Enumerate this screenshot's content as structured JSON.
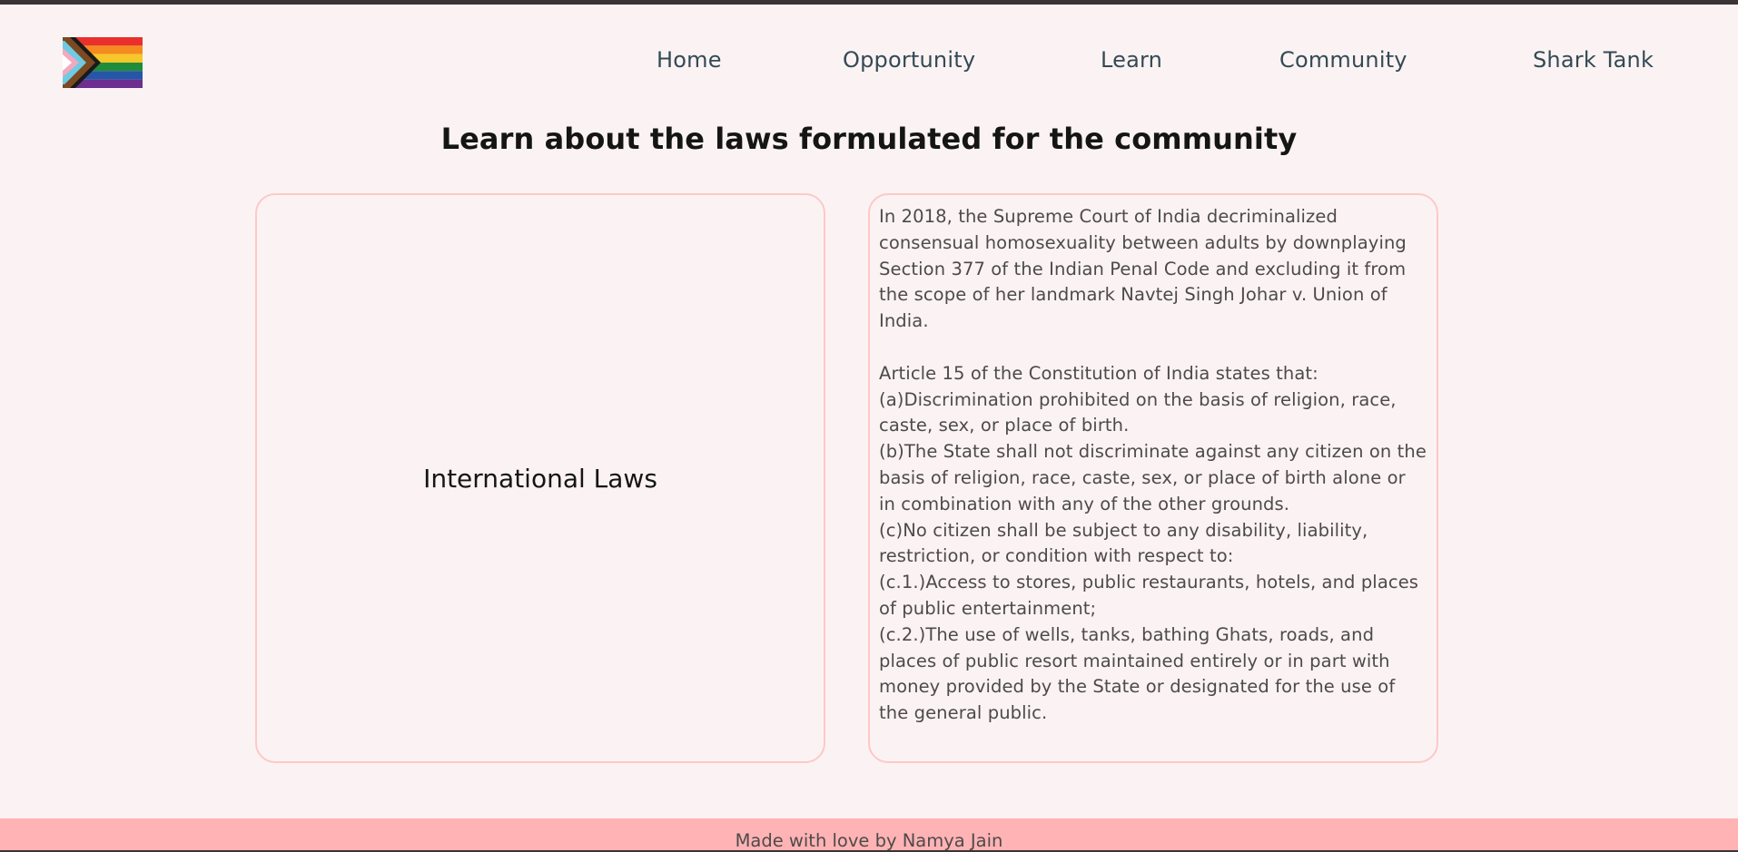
{
  "nav": {
    "items": [
      "Home",
      "Opportunity",
      "Learn",
      "Community",
      "Shark Tank"
    ]
  },
  "logo": {
    "icon": "progress-pride-flag-icon",
    "colors": {
      "red": "#e9302d",
      "orange": "#f58b1f",
      "yellow": "#f5c72a",
      "green": "#1f8c3c",
      "blue": "#2656a7",
      "purple": "#6c2e8f",
      "black": "#1a1a1a",
      "brown": "#7b4a22",
      "light_blue": "#6fcbe3",
      "pink": "#f5a7bf",
      "white": "#ffffff"
    }
  },
  "main": {
    "heading": "Learn about the laws formulated for the community",
    "left_card": {
      "title": "International Laws"
    },
    "right_card": {
      "paragraph_1": "In 2018, the Supreme Court of India decriminalized consensual homosexuality between adults by downplaying Section 377 of the Indian Penal Code and excluding it from the scope of her landmark Navtej Singh Johar v. Union of India.",
      "article_intro": "Article 15 of the Constitution of India states that:",
      "clauses": [
        "(a)Discrimination prohibited on the basis of religion, race, caste, sex, or place of birth.",
        "(b)The State shall not discriminate against any citizen on the basis of religion, race, caste, sex, or place of birth alone or in combination with any of the other grounds.",
        "(c)No citizen shall be subject to any disability, liability, restriction, or condition with respect to:",
        "(c.1.)Access to stores, public restaurants, hotels, and places of public entertainment;",
        "(c.2.)The use of wells, tanks, bathing Ghats, roads, and places of public resort maintained entirely or in part with money provided by the State or designated for the use of the general public."
      ]
    }
  },
  "footer": {
    "text": "Made with love by Namya Jain"
  },
  "colors": {
    "background": "#fbf3f3",
    "card_border": "#ffc7c9",
    "footer_bg": "#ffb3b4",
    "nav_text": "#344a55"
  }
}
